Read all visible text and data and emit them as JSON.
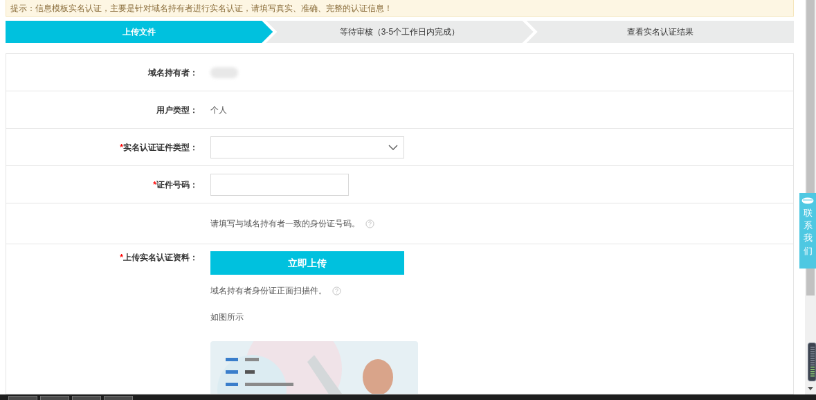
{
  "notice": "提示：信息模板实名认证，主要是针对域名持有者进行实名认证，请填写真实、准确、完整的认证信息！",
  "steps": [
    {
      "label": "上传文件",
      "selected": true
    },
    {
      "label": "等待审核（3-5个工作日内完成）",
      "selected": false
    },
    {
      "label": "查看实名认证结果",
      "selected": false
    }
  ],
  "form": {
    "rows": [
      {
        "kind": "redacted",
        "label": "域名持有者：",
        "required": false
      },
      {
        "kind": "text",
        "label": "用户类型：",
        "required": false,
        "value": "个人"
      },
      {
        "kind": "select",
        "label": "实名认证证件类型：",
        "required": true
      },
      {
        "kind": "input",
        "label": "证件号码：",
        "required": true
      },
      {
        "kind": "hint",
        "hint": "请填写与域名持有者一致的身份证号码。"
      },
      {
        "kind": "upload",
        "label": "上传实名认证资料：",
        "required": true,
        "button": "立即上传",
        "hint": "域名持有者身份证正面扫描件。",
        "caption": "如图所示"
      }
    ]
  },
  "required_mark": "*",
  "contact_tab": "联系我们"
}
